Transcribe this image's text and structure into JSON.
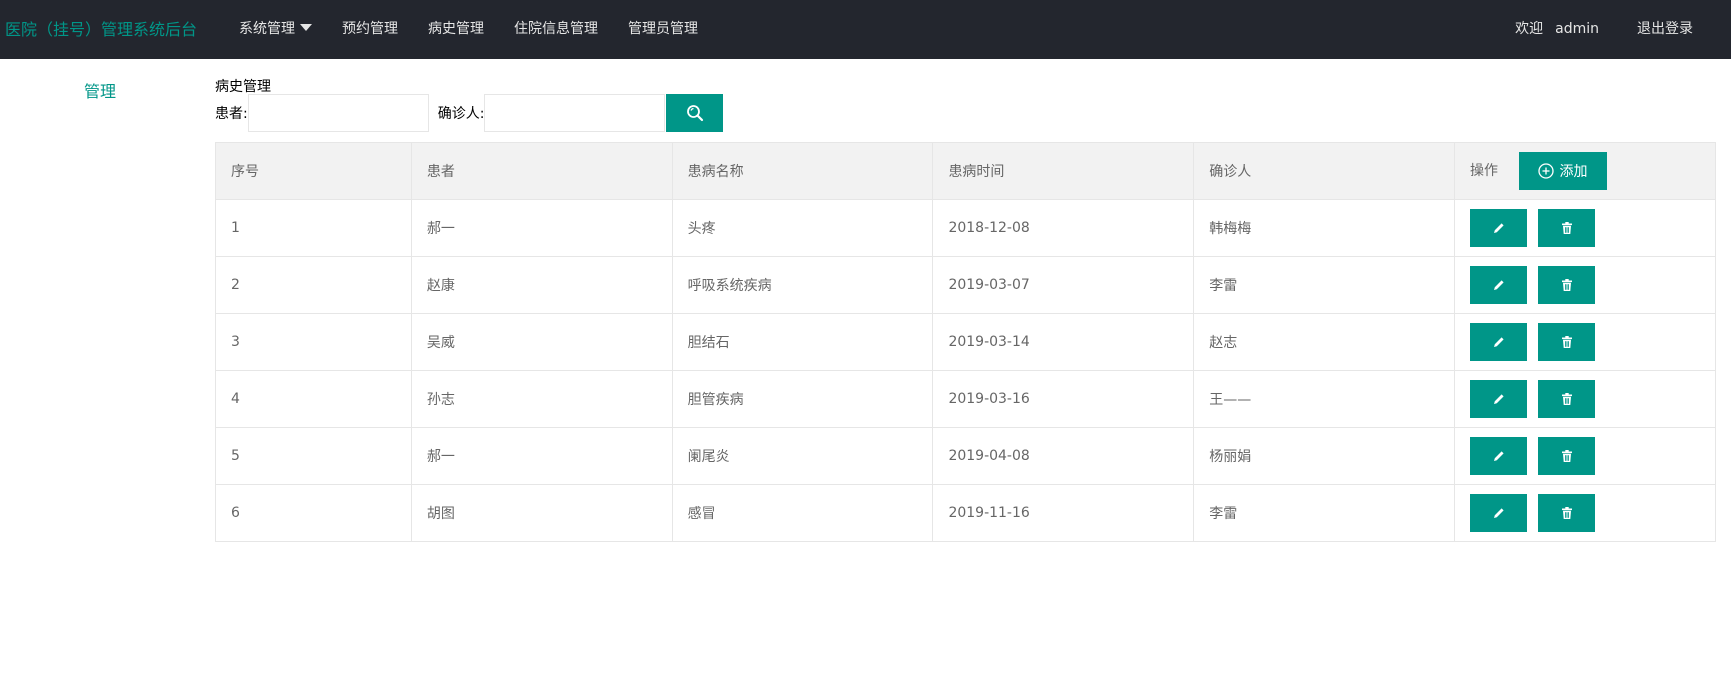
{
  "header": {
    "brand": "医院（挂号）管理系统后台",
    "nav": [
      "系统管理",
      "预约管理",
      "病史管理",
      "住院信息管理",
      "管理员管理"
    ],
    "welcome": "欢迎",
    "username": "admin",
    "logout": "退出登录"
  },
  "sidebar": {
    "title": "管理"
  },
  "content": {
    "title": "病史管理",
    "search": {
      "patient_label": "患者:",
      "patient_value": "",
      "diag_label": "确诊人:",
      "diag_value": ""
    },
    "table": {
      "headers": [
        "序号",
        "患者",
        "患病名称",
        "患病时间",
        "确诊人",
        "操作"
      ],
      "add_label": "添加",
      "rows": [
        [
          "1",
          "郝一",
          "头疼",
          "2018-12-08",
          "韩梅梅"
        ],
        [
          "2",
          "赵康",
          "呼吸系统疾病",
          "2019-03-07",
          "李雷"
        ],
        [
          "3",
          "吴威",
          "胆结石",
          "2019-03-14",
          "赵志"
        ],
        [
          "4",
          "孙志",
          "胆管疾病",
          "2019-03-16",
          "王——"
        ],
        [
          "5",
          "郝一",
          "阑尾炎",
          "2019-04-08",
          "杨丽娟"
        ],
        [
          "6",
          "胡图",
          "感冒",
          "2019-11-16",
          "李雷"
        ]
      ]
    }
  },
  "colors": {
    "accent": "#009688",
    "header_bg": "#23262e",
    "table_head_bg": "#f2f2f2"
  },
  "icons": {
    "search": "search-icon",
    "add": "plus-circle-icon",
    "edit": "pencil-icon",
    "delete": "trash-icon"
  }
}
